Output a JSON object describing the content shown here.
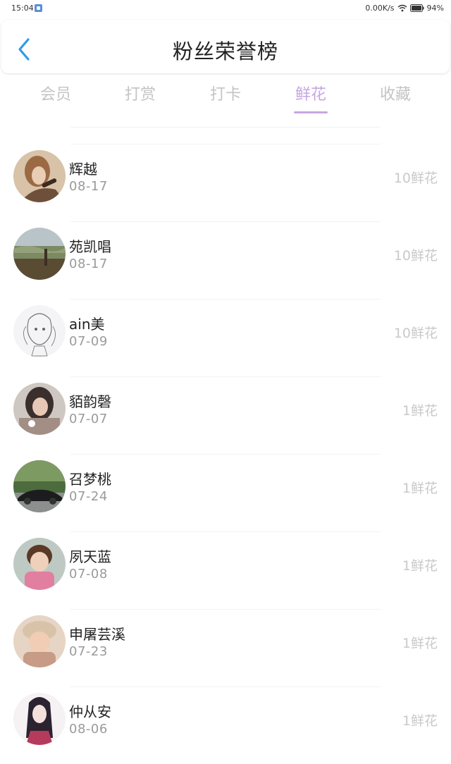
{
  "status": {
    "time": "15:04",
    "speed": "0.00K/s",
    "battery": "94%"
  },
  "header": {
    "title": "粉丝荣誉榜"
  },
  "tabs": [
    {
      "label": "会员",
      "active": false
    },
    {
      "label": "打赏",
      "active": false
    },
    {
      "label": "打卡",
      "active": false
    },
    {
      "label": "鲜花",
      "active": true
    },
    {
      "label": "收藏",
      "active": false
    }
  ],
  "colors": {
    "accent": "#c7a6e2",
    "back": "#2f9be8"
  },
  "list": [
    {
      "name": "辉越",
      "date": "08-17",
      "count": "10鲜花",
      "avatar": "avatar-portrait-woman"
    },
    {
      "name": "苑凯唱",
      "date": "08-17",
      "count": "10鲜花",
      "avatar": "avatar-landscape"
    },
    {
      "name": "ain美",
      "date": "07-09",
      "count": "10鲜花",
      "avatar": "avatar-sketch"
    },
    {
      "name": "貊韵磬",
      "date": "07-07",
      "count": "1鲜花",
      "avatar": "avatar-girl-dark"
    },
    {
      "name": "召梦桃",
      "date": "07-24",
      "count": "1鲜花",
      "avatar": "avatar-car"
    },
    {
      "name": "夙天蓝",
      "date": "07-08",
      "count": "1鲜花",
      "avatar": "avatar-child"
    },
    {
      "name": "申屠芸溪",
      "date": "07-23",
      "count": "1鲜花",
      "avatar": "avatar-baby"
    },
    {
      "name": "仲从安",
      "date": "08-06",
      "count": "1鲜花",
      "avatar": "avatar-anime"
    }
  ]
}
